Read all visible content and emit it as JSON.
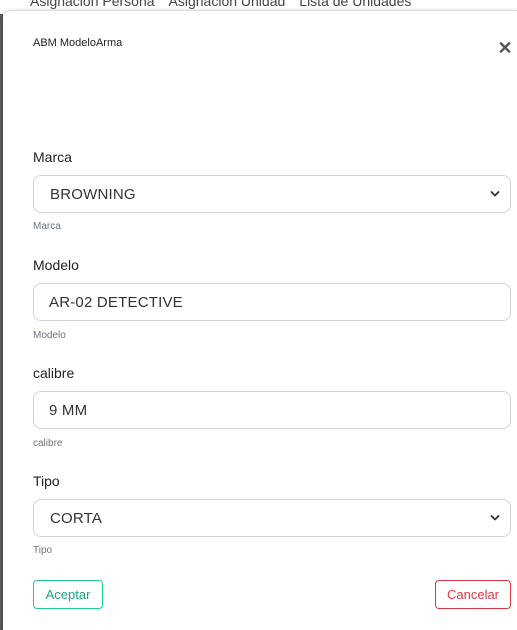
{
  "background": {
    "tabs": [
      "Asignación Persona",
      "Asignación Unidad",
      "Lista de Unidades"
    ]
  },
  "modal": {
    "title": "ABM ModeloArma",
    "close_icon": "close-icon"
  },
  "form": {
    "marca": {
      "label": "Marca",
      "value": "BROWNING",
      "help": "Marca",
      "control": "select"
    },
    "modelo": {
      "label": "Modelo",
      "value": "AR-02 DETECTIVE",
      "help": "Modelo",
      "control": "input"
    },
    "calibre": {
      "label": "calibre",
      "value": "9 MM",
      "help": "calibre",
      "control": "input"
    },
    "tipo": {
      "label": "Tipo",
      "value": "CORTA",
      "help": "Tipo",
      "control": "select"
    }
  },
  "actions": {
    "accept_label": "Aceptar",
    "cancel_label": "Cancelar"
  },
  "colors": {
    "accept": "#20c997",
    "cancel": "#dc3545",
    "border": "#ced4da"
  }
}
